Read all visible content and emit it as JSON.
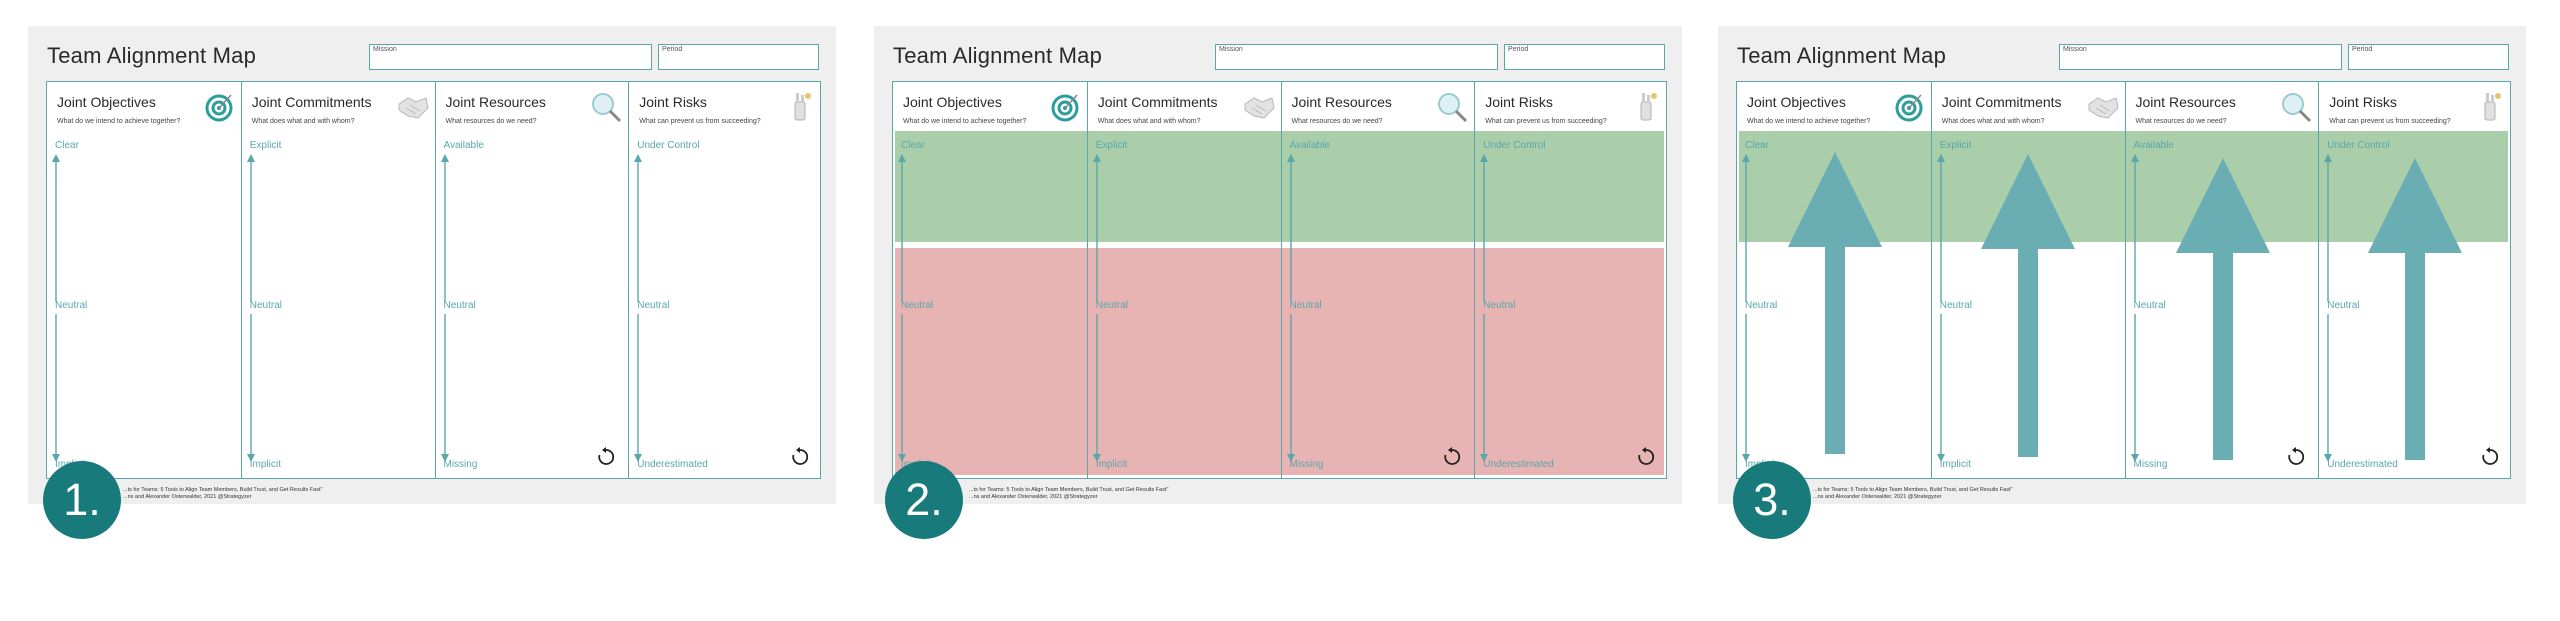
{
  "title": "Team Alignment Map",
  "fields": {
    "mission": "Mission",
    "period": "Period"
  },
  "columns": [
    {
      "heading": "Joint Objectives",
      "question": "What do we intend to achieve together?",
      "top": "Clear",
      "mid": "Neutral",
      "bottom": "Implicit",
      "icon": "target-icon"
    },
    {
      "heading": "Joint Commitments",
      "question": "What does what and with whom?",
      "top": "Explicit",
      "mid": "Neutral",
      "bottom": "Implicit",
      "icon": "handshake-icon"
    },
    {
      "heading": "Joint Resources",
      "question": "What resources do we need?",
      "top": "Available",
      "mid": "Neutral",
      "bottom": "Missing",
      "icon": "magnifier-icon"
    },
    {
      "heading": "Joint Risks",
      "question": "What can prevent us from succeeding?",
      "top": "Under Control",
      "mid": "Neutral",
      "bottom": "Underestimated",
      "icon": "robot-hand-icon"
    }
  ],
  "footer": {
    "line1": "...ts for Teams: 5 Tools to Align Team Members, Build Trust, and Get Results Fast\"",
    "line2": "...ns and Alexander Osterwalder, 2021   @Strategyzer"
  },
  "steps": [
    "1.",
    "2.",
    "3."
  ],
  "colors": {
    "teal": "#5aa7ab",
    "dark_teal": "#187a7a",
    "green_zone": "#8cbe8c",
    "red_zone": "#de9696",
    "arrow": "#6aaeb3"
  }
}
